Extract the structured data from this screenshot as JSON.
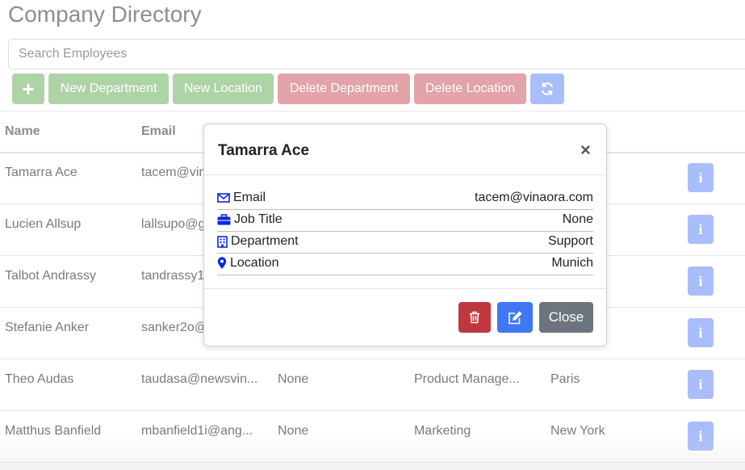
{
  "header": {
    "title": "Company Directory"
  },
  "search": {
    "placeholder": "Search Employees"
  },
  "toolbar": {
    "add_label": "+",
    "new_department": "New Department",
    "new_location": "New Location",
    "delete_department": "Delete Department",
    "delete_location": "Delete Location"
  },
  "table": {
    "columns": [
      "Name",
      "Email"
    ],
    "rows": [
      {
        "name": "Tamarra Ace",
        "email": "tacem@vin",
        "job": "",
        "department": "",
        "location": ""
      },
      {
        "name": "Lucien Allsup",
        "email": "lallsupo@g",
        "job": "",
        "department": "",
        "location": ""
      },
      {
        "name": "Talbot Andrassy",
        "email": "tandrassy1",
        "job": "",
        "department": "",
        "location": ""
      },
      {
        "name": "Stefanie Anker",
        "email": "sanker2o@",
        "job": "",
        "department": "",
        "location": ""
      },
      {
        "name": "Theo Audas",
        "email": "taudasa@newsvin...",
        "job": "None",
        "department": "Product Manage...",
        "location": "Paris"
      },
      {
        "name": "Matthus Banfield",
        "email": "mbanfield1i@ang...",
        "job": "None",
        "department": "Marketing",
        "location": "New York"
      }
    ],
    "info_label": "i"
  },
  "modal": {
    "title": "Tamarra Ace",
    "close_x": "×",
    "fields": [
      {
        "label": "Email",
        "value": "tacem@vinaora.com",
        "icon": "envelope-icon"
      },
      {
        "label": "Job Title",
        "value": "None",
        "icon": "briefcase-icon"
      },
      {
        "label": "Department",
        "value": "Support",
        "icon": "building-icon"
      },
      {
        "label": "Location",
        "value": "Munich",
        "icon": "map-pin-icon"
      }
    ],
    "close_label": "Close"
  },
  "colors": {
    "accent_blue": "#0d25e6",
    "danger": "#c0373f",
    "primary": "#3f78f2",
    "secondary": "#6c757d"
  }
}
